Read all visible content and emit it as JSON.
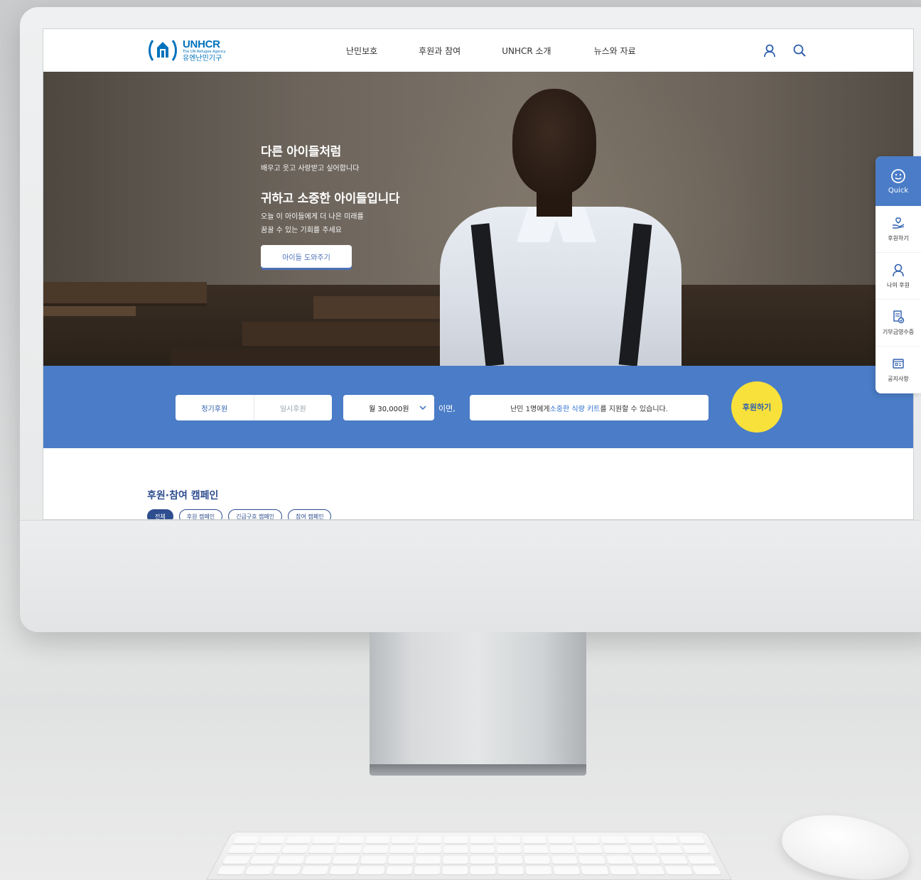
{
  "header": {
    "logo_name": "UNHCR",
    "logo_sub": "The UN Refugee Agency",
    "logo_kr": "유엔난민기구",
    "nav": [
      "난민보호",
      "후원과 참여",
      "UNHCR 소개",
      "뉴스와 자료"
    ],
    "icons": [
      "user-icon",
      "search-icon"
    ]
  },
  "hero": {
    "line1": "다른 아이들처럼",
    "line2": "배우고 웃고 사랑받고 싶어합니다",
    "line3": "귀하고 소중한 아이들입니다",
    "line4": "오늘 이 아이들에게 더 나은 미래를",
    "line5": "꿈꿀 수 있는 기회를 주세요",
    "button": "아이들 도와주기"
  },
  "quick": {
    "title": "Quick",
    "items": [
      {
        "label": "후원하기",
        "icon": "heart-hand-icon"
      },
      {
        "label": "나의 후원",
        "icon": "user-icon"
      },
      {
        "label": "기부금영수증",
        "icon": "receipt-icon"
      },
      {
        "label": "공지사항",
        "icon": "notice-icon"
      }
    ]
  },
  "donate": {
    "option_regular": "정기후원",
    "option_once": "일시후원",
    "amount": "월 30,000원",
    "suffix": "이면,",
    "msg_pre": "난민 1명에게 ",
    "msg_hl": "소중한 식량 키트",
    "msg_post": "를 지원할 수 있습니다.",
    "button": "후원하기"
  },
  "campaign": {
    "title": "후원·참여 캠페인",
    "chips": [
      "전체",
      "후원 캠페인",
      "긴급구호 캠페인",
      "참여 캠페인"
    ]
  },
  "colors": {
    "primary": "#4a7cc7",
    "brand": "#0072bc",
    "accent": "#f8e13a",
    "navy": "#2e4e8f"
  }
}
